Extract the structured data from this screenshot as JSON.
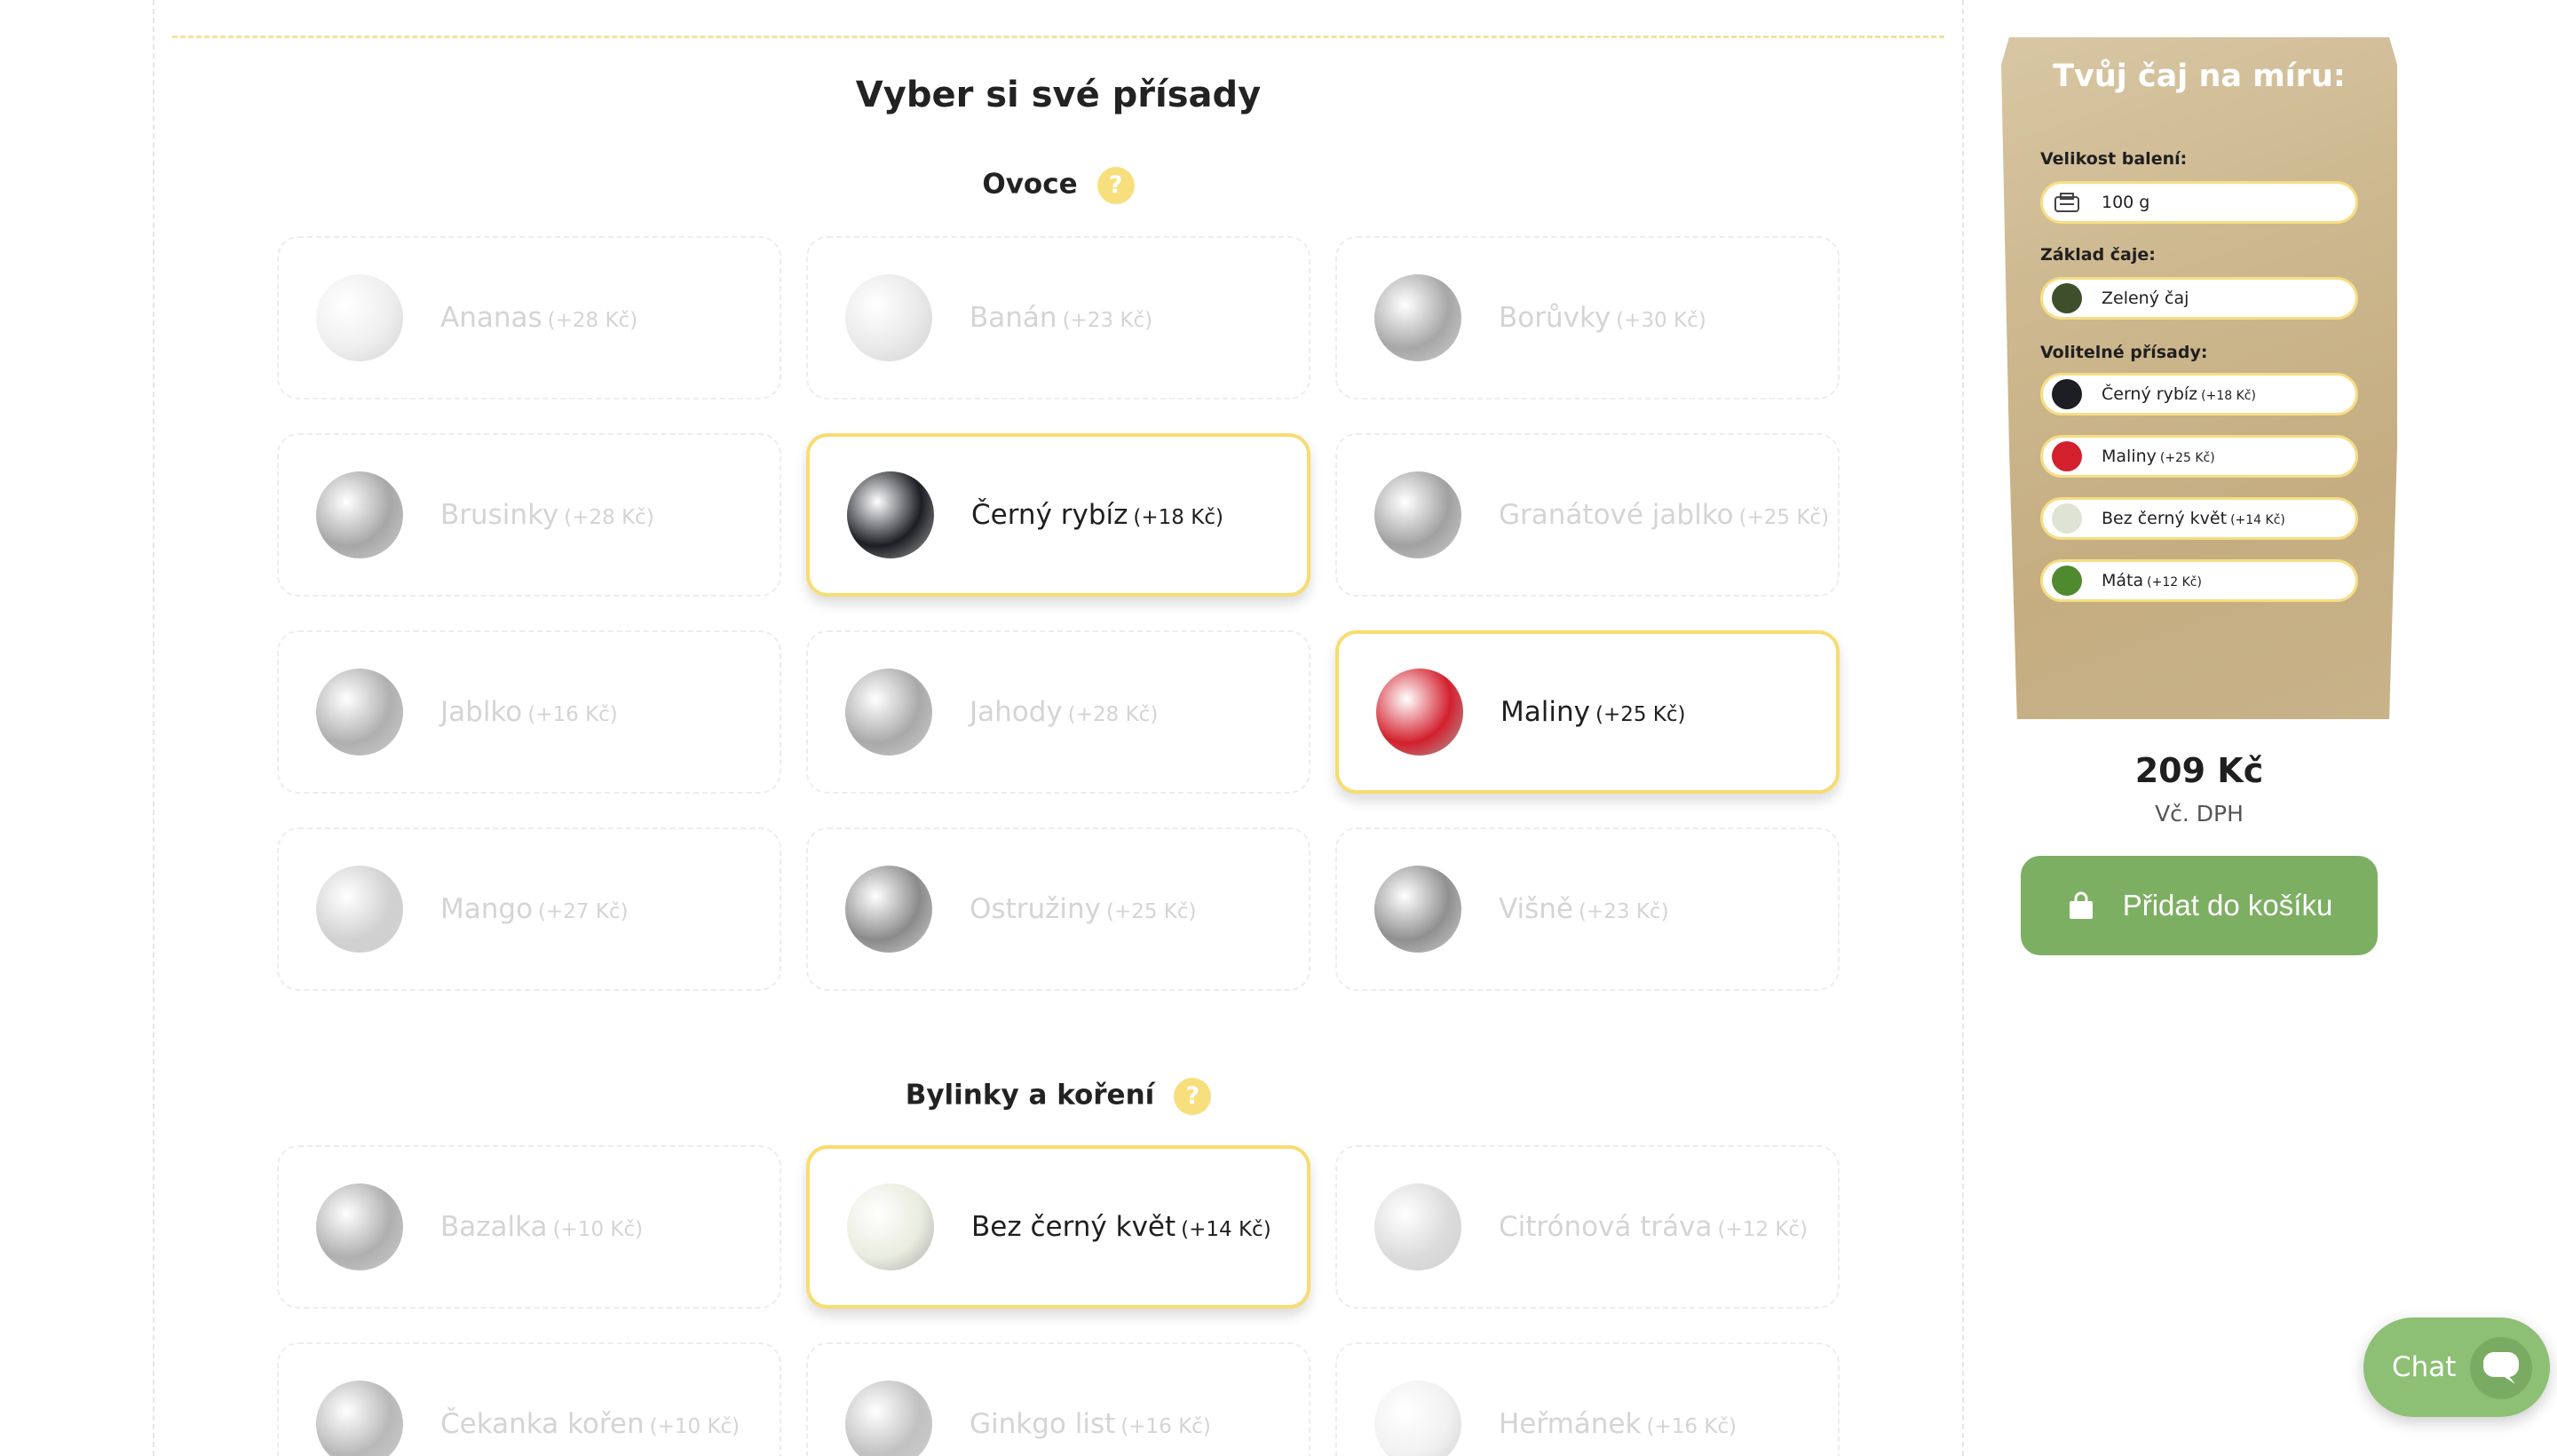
{
  "section_title": "Vyber si své přísady",
  "categories": [
    {
      "name": "Ovoce",
      "help": "?",
      "items": [
        {
          "name": "Ananas",
          "price": "(+28 Kč)",
          "selected": false,
          "color": "#e7e2c8"
        },
        {
          "name": "Banán",
          "price": "(+23 Kč)",
          "selected": false,
          "color": "#e8d98a"
        },
        {
          "name": "Borůvky",
          "price": "(+30 Kč)",
          "selected": false,
          "color": "#4d5f8c"
        },
        {
          "name": "Brusinky",
          "price": "(+28 Kč)",
          "selected": false,
          "color": "#b7473f"
        },
        {
          "name": "Černý rybíz",
          "price": "(+18 Kč)",
          "selected": true,
          "color": "#1c1e24"
        },
        {
          "name": "Granátové jablko",
          "price": "(+25 Kč)",
          "selected": false,
          "color": "#b33a38"
        },
        {
          "name": "Jablko",
          "price": "(+16 Kč)",
          "selected": false,
          "color": "#c35a3a"
        },
        {
          "name": "Jahody",
          "price": "(+28 Kč)",
          "selected": false,
          "color": "#d3453e"
        },
        {
          "name": "Maliny",
          "price": "(+25 Kč)",
          "selected": true,
          "color": "#d3202d"
        },
        {
          "name": "Mango",
          "price": "(+27 Kč)",
          "selected": false,
          "color": "#f0a239"
        },
        {
          "name": "Ostružiny",
          "price": "(+25 Kč)",
          "selected": false,
          "color": "#2f2a36"
        },
        {
          "name": "Višně",
          "price": "(+23 Kč)",
          "selected": false,
          "color": "#8d1d24"
        }
      ]
    },
    {
      "name": "Bylinky a koření",
      "help": "?",
      "items": [
        {
          "name": "Bazalka",
          "price": "(+10 Kč)",
          "selected": false,
          "color": "#4b7d3a"
        },
        {
          "name": "Bez černý květ",
          "price": "(+14 Kč)",
          "selected": true,
          "color": "#e9ecdf"
        },
        {
          "name": "Citrónová tráva",
          "price": "(+12 Kč)",
          "selected": false,
          "color": "#b9c58c"
        },
        {
          "name": "Čekanka kořen",
          "price": "(+10 Kč)",
          "selected": false,
          "color": "#9a7a55"
        },
        {
          "name": "Ginkgo list",
          "price": "(+16 Kč)",
          "selected": false,
          "color": "#7e9b3e"
        },
        {
          "name": "Heřmánek",
          "price": "(+16 Kč)",
          "selected": false,
          "color": "#f2e7b0"
        }
      ]
    }
  ],
  "pouch": {
    "title": "Tvůj čaj na míru:",
    "size_label": "Velikost balení:",
    "size_value": "100 g",
    "base_label": "Základ čaje:",
    "base_value": "Zelený čaj",
    "base_color": "#3f4f2c",
    "extras_label": "Volitelné přísady:",
    "extras": [
      {
        "name": "Černý rybíz",
        "price": "(+18 Kč)",
        "color": "#1c1e24"
      },
      {
        "name": "Maliny",
        "price": "(+25 Kč)",
        "color": "#d3202d"
      },
      {
        "name": "Bez černý květ",
        "price": "(+14 Kč)",
        "color": "#dfe3d3"
      },
      {
        "name": "Máta",
        "price": "(+12 Kč)",
        "color": "#4f8a2e"
      }
    ]
  },
  "total": {
    "price": "209 Kč",
    "vat": "Vč. DPH"
  },
  "cart_button": "Přidat do košíku",
  "chat": {
    "label": "Chat"
  },
  "colors": {
    "accent_yellow": "#f7dc72",
    "button_green": "#7daf63",
    "chat_green": "#8dbf74"
  }
}
